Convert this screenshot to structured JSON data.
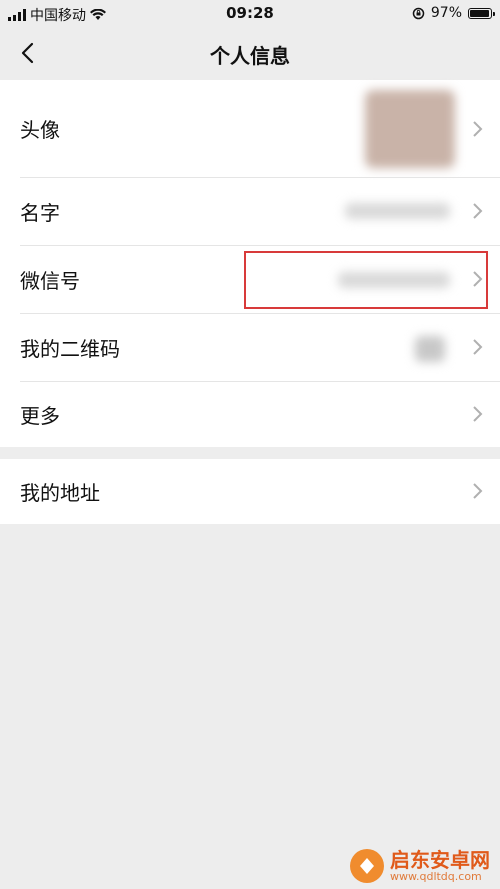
{
  "status_bar": {
    "carrier": "中国移动",
    "time": "09:28",
    "battery": "97%",
    "battery_level": 0.97
  },
  "nav": {
    "title": "个人信息",
    "back_icon": "chevron-left-icon"
  },
  "rows": [
    {
      "label": "头像"
    },
    {
      "label": "名字"
    },
    {
      "label": "微信号"
    },
    {
      "label": "我的二维码"
    },
    {
      "label": "更多"
    }
  ],
  "rows2": [
    {
      "label": "我的地址"
    }
  ],
  "highlight_color": "#d83a3a",
  "watermark": {
    "name": "启东安卓网",
    "url": "www.qdltdq.com"
  }
}
